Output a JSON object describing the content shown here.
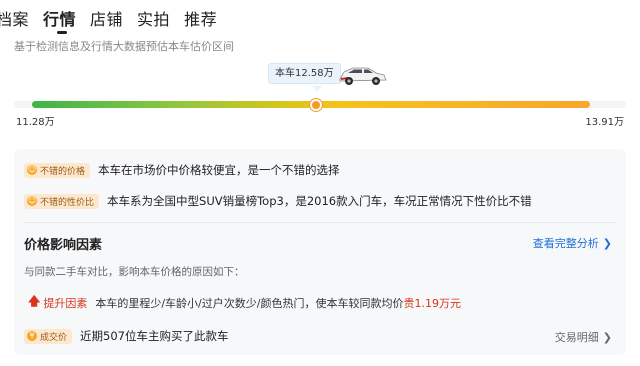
{
  "tabs": [
    {
      "label": "档案"
    },
    {
      "label": "行情"
    },
    {
      "label": "店铺"
    },
    {
      "label": "实拍"
    },
    {
      "label": "推荐"
    }
  ],
  "active_tab": "行情",
  "subtitle": "基于检测信息及行情大数据预估本车估价区间",
  "estimate": {
    "label": "本车12.58万",
    "min_label": "11.28万",
    "max_label": "13.91万",
    "min": 11.28,
    "max": 13.91,
    "value": 12.58
  },
  "highlights": [
    {
      "badge": "不错的价格",
      "text": "本车在市场价中价格较便宜，是一个不错的选择"
    },
    {
      "badge": "不错的性价比",
      "text": "本车系为全国中型SUV销量榜Top3，是2016款入门车，车况正常情况下性价比不错"
    }
  ],
  "factors": {
    "title": "价格影响因素",
    "more_label": "查看完整分析",
    "compare_text": "与同款二手车对比，影响本车价格的原因如下：",
    "up_name": "提升因素",
    "up_desc": "本车的里程少/车龄小/过户次数少/颜色热门，使本车较同款均价",
    "up_price": "贵1.19万元"
  },
  "deal": {
    "badge": "成交价",
    "text": "近期507位车主购买了此款车",
    "detail_label": "交易明细"
  },
  "colors": {
    "accent_orange": "#f59a23",
    "price_red": "#d9351c",
    "link_blue": "#1f6fd6"
  }
}
